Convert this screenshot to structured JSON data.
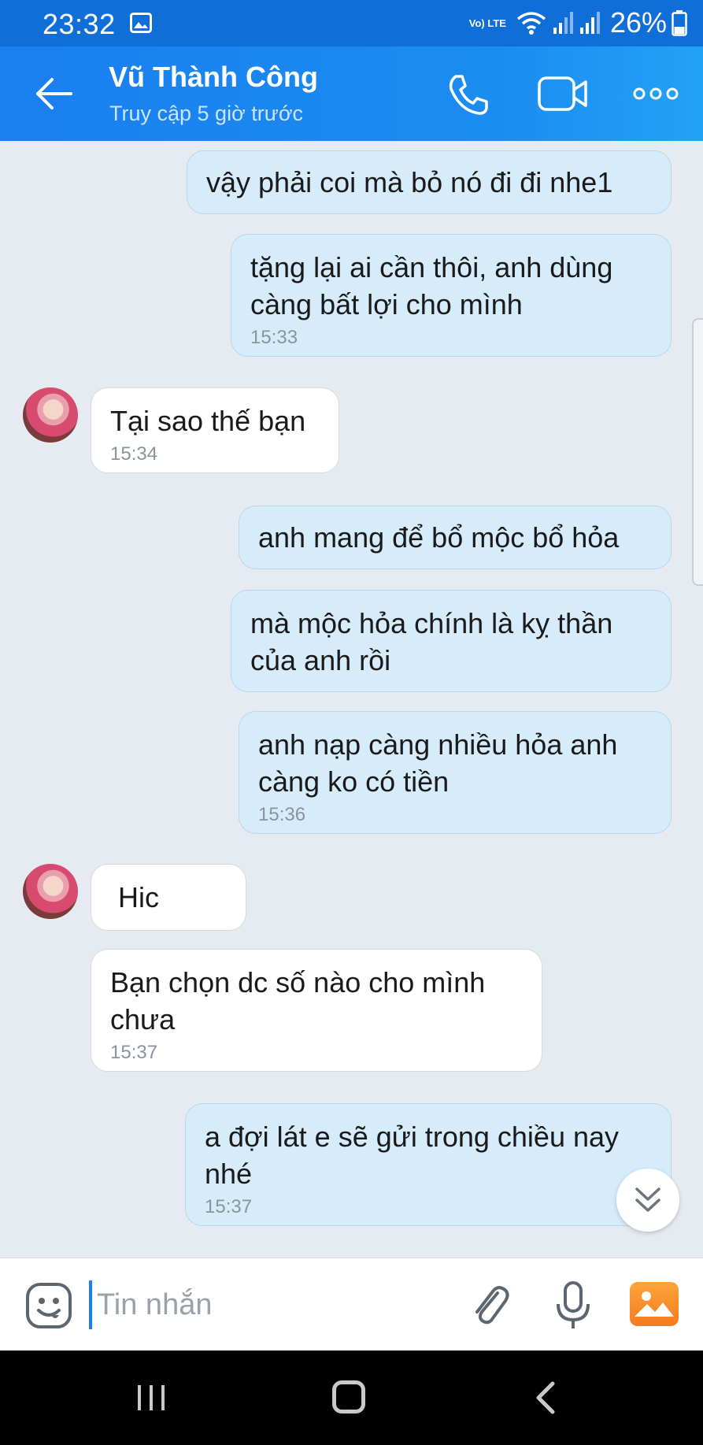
{
  "status_bar": {
    "time": "23:32",
    "network_label": "Vo) LTE",
    "battery_percent": "26%",
    "icons": [
      "image-icon",
      "wifi-icon",
      "signal-icon",
      "signal-icon",
      "battery-icon"
    ]
  },
  "header": {
    "contact_name": "Vũ Thành Công",
    "last_seen": "Truy cập 5 giờ trước",
    "icons": [
      "back-arrow-icon",
      "phone-icon",
      "video-camera-icon",
      "more-dots-icon"
    ]
  },
  "messages": [
    {
      "direction": "out",
      "text": "vậy phải coi mà bỏ nó đi đi nhe1",
      "time": ""
    },
    {
      "direction": "out",
      "text": "tặng lại ai cần thôi, anh dùng càng bất lợi cho mình",
      "time": "15:33"
    },
    {
      "direction": "in",
      "text": "Tại sao thế bạn",
      "time": "15:34"
    },
    {
      "direction": "out",
      "text": "anh mang để bổ mộc bổ hỏa",
      "time": ""
    },
    {
      "direction": "out",
      "text": "mà mộc hỏa chính là kỵ thần của anh rồi",
      "time": ""
    },
    {
      "direction": "out",
      "text": "anh nạp càng nhiều hỏa anh càng ko có tiền",
      "time": "15:36"
    },
    {
      "direction": "in",
      "text": "Hic",
      "time": ""
    },
    {
      "direction": "in",
      "text": "Bạn chọn dc số nào cho mình chưa",
      "time": "15:37"
    },
    {
      "direction": "out",
      "text": "a đợi lát e sẽ gửi trong chiều nay nhé",
      "time": "15:37"
    }
  ],
  "composer": {
    "placeholder": "Tin nhắn",
    "value": "",
    "icons": [
      "emoji-icon",
      "paperclip-icon",
      "microphone-icon",
      "gallery-icon"
    ]
  },
  "colors": {
    "header_blue": "#1a7ff0",
    "outgoing_bubble": "#d6ecfb",
    "incoming_bubble": "#ffffff",
    "chat_background": "#e6eaf1"
  }
}
